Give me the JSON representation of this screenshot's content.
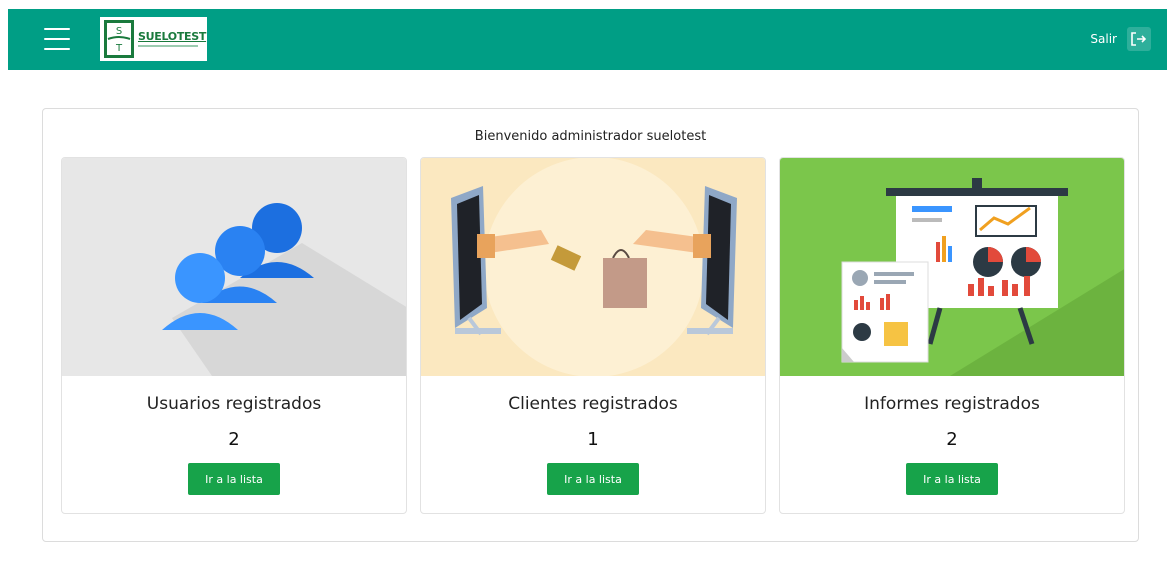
{
  "header": {
    "logo_text": "SUELOTEST",
    "logout_label": "Salir"
  },
  "main": {
    "welcome": "Bienvenido administrador suelotest",
    "cards": [
      {
        "title": "Usuarios registrados",
        "count": "2",
        "button_label": "Ir a la lista",
        "image": "users-illustration"
      },
      {
        "title": "Clientes registrados",
        "count": "1",
        "button_label": "Ir a la lista",
        "image": "clients-illustration"
      },
      {
        "title": "Informes registrados",
        "count": "2",
        "button_label": "Ir a la lista",
        "image": "reports-illustration"
      }
    ]
  },
  "colors": {
    "header_bg": "#009e85",
    "button_bg": "#17a34a",
    "users_icon": "#1a7cf0",
    "clients_bg": "#fbe8c0",
    "reports_bg": "#7bc64b"
  }
}
